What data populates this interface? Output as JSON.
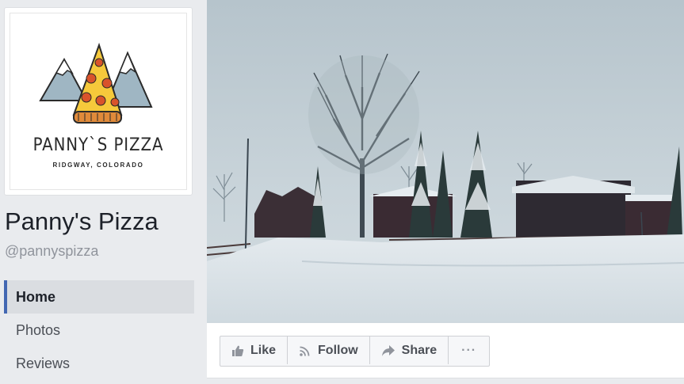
{
  "page": {
    "name": "Panny's Pizza",
    "handle": "@pannyspizza"
  },
  "logo": {
    "name": "PANNY`S PIZZA",
    "location": "RIDGWAY, COLORADO"
  },
  "nav": {
    "items": [
      {
        "label": "Home",
        "active": true
      },
      {
        "label": "Photos",
        "active": false
      },
      {
        "label": "Reviews",
        "active": false
      }
    ]
  },
  "actions": {
    "like_label": "Like",
    "follow_label": "Follow",
    "share_label": "Share",
    "more_label": "···",
    "like_icon": "thumbs-up-icon",
    "follow_icon": "rss-icon",
    "share_icon": "share-arrow-icon",
    "more_icon": "more-dots-icon"
  },
  "colors": {
    "accent": "#4267b2",
    "background": "#e9ebee",
    "text_primary": "#1d2129",
    "text_secondary": "#90949c"
  }
}
